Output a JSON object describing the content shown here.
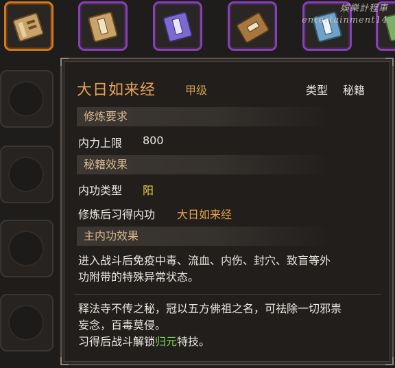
{
  "watermark": {
    "line1": "娛樂計程車",
    "line2": "entertainment14"
  },
  "inventory": {
    "top_slots": [
      {
        "icon": "scroll-book-icon",
        "color": "#c9a46a",
        "selected": true
      },
      {
        "icon": "tan-book-icon",
        "color": "#c9a46a",
        "selected": false
      },
      {
        "icon": "purple-book-icon",
        "color": "#7d6ad1",
        "selected": false
      },
      {
        "icon": "brown-book-icon",
        "color": "#a7773f",
        "selected": false
      },
      {
        "icon": "blue-book-icon",
        "color": "#6fa2c4",
        "selected": false
      },
      {
        "icon": "green-book-icon",
        "color": "#7fae6a",
        "selected": false
      }
    ]
  },
  "tooltip": {
    "title": "大日如来经",
    "grade": "甲级",
    "type_label": "类型",
    "type_value": "秘籍",
    "sections": {
      "requirement_header": "修炼要求",
      "inner_power_label": "内力上限",
      "inner_power_value": "800",
      "effect_header": "秘籍效果",
      "skill_type_label": "内功类型",
      "skill_type_value": "阳",
      "learned_label": "修炼后习得内功",
      "learned_value": "大日如来经",
      "main_effect_header": "主内功效果",
      "main_effect_text_1": "进入战斗后免疫中毒、流血、内伤、封穴、致盲等外",
      "main_effect_text_2": "功附带的特殊异常状态。"
    },
    "description_1": "释法寺不传之秘，冠以五方佛祖之名，可祛除一切邪祟",
    "description_2": "妄念，百毒莫侵。",
    "learn_prefix": "习得后战斗解锁",
    "learn_highlight": "归元",
    "learn_suffix": "特技。"
  }
}
